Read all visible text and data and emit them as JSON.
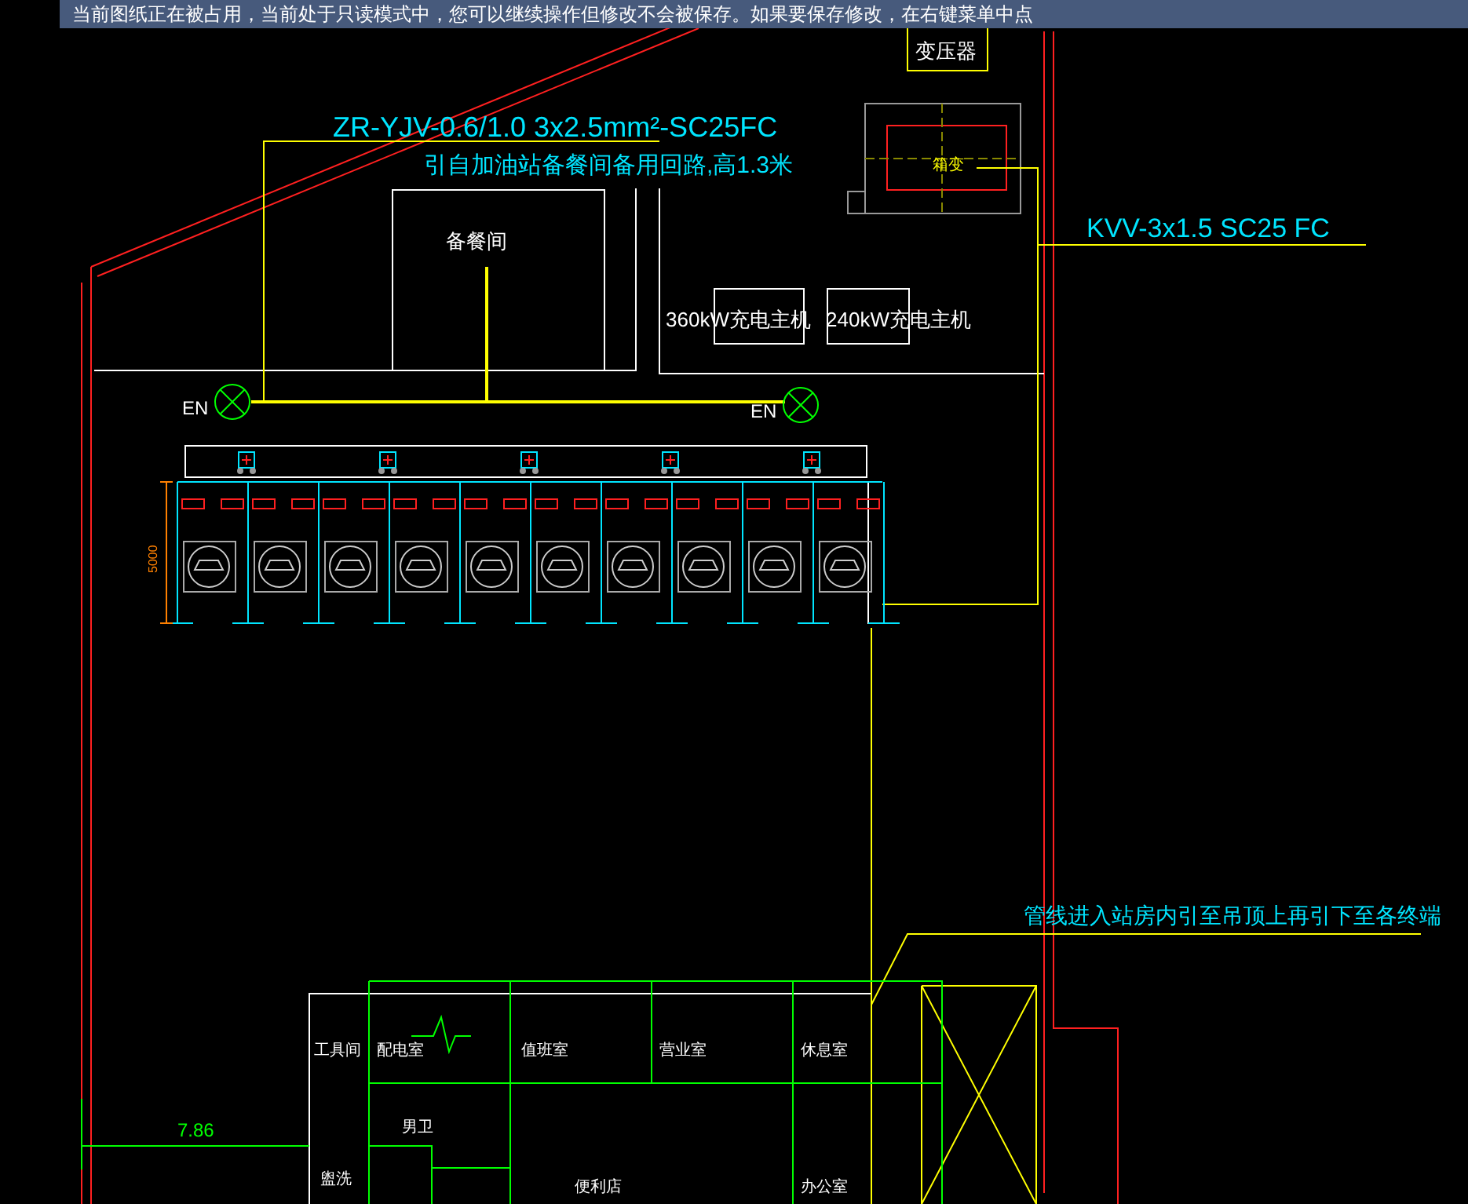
{
  "banner": {
    "text": "当前图纸正在被占用，当前处于只读模式中，您可以继续操作但修改不会被保存。如果要保存修改，在右键菜单中点"
  },
  "labels": [
    {
      "text": "变压器",
      "color": "#ffffff"
    },
    {
      "text": "ZR-YJV-0.6/1.0 3x2.5mm²-SC25FC",
      "color": "#00e5ff"
    },
    {
      "text": "引自加油站备餐间备用回路,高1.3米",
      "color": "#00e5ff"
    },
    {
      "text": "箱变",
      "color": "#ffff00"
    },
    {
      "text": "KVV-3x1.5 SC25 FC",
      "color": "#00e5ff"
    },
    {
      "text": "备餐间",
      "color": "#ffffff"
    },
    {
      "text": "360kW充电主机",
      "color": "#ffffff"
    },
    {
      "text": "240kW充电主机",
      "color": "#ffffff"
    },
    {
      "text": "EN",
      "color": "#ffffff"
    },
    {
      "text": "EN",
      "color": "#ffffff"
    },
    {
      "text": "5000",
      "color": "#ff8000"
    },
    {
      "text": "管线进入站房内引至吊顶上再引下至各终端",
      "color": "#00e5ff"
    },
    {
      "text": "工具间",
      "color": "#ffffff"
    },
    {
      "text": "配电室",
      "color": "#ffffff"
    },
    {
      "text": "值班室",
      "color": "#ffffff"
    },
    {
      "text": "营业室",
      "color": "#ffffff"
    },
    {
      "text": "休息室",
      "color": "#ffffff"
    },
    {
      "text": "男卫",
      "color": "#ffffff"
    },
    {
      "text": "盥洗",
      "color": "#ffffff"
    },
    {
      "text": "便利店",
      "color": "#ffffff"
    },
    {
      "text": "办公室",
      "color": "#ffffff"
    },
    {
      "text": "7.86",
      "color": "#00ff00"
    }
  ]
}
